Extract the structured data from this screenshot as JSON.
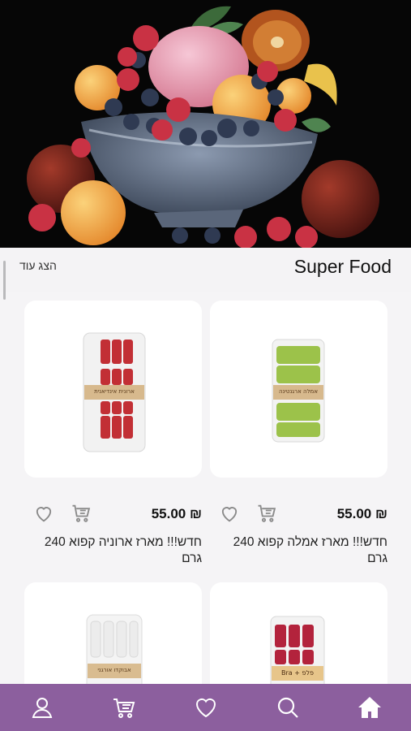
{
  "section": {
    "title": "Super Food",
    "show_more": "הצג עוד"
  },
  "products": [
    {
      "name": "חדש!!! מארז אמלה קפוא 240 גרם",
      "price": "₪ 55.00",
      "package_label": "אמלה ארגנטינה",
      "fill_color": "#9cc24a"
    },
    {
      "name": "חדש!!! מארז ארוניה קפוא 240 גרם",
      "price": "₪ 55.00",
      "package_label": "ארונית אינדיאנית",
      "fill_color": "#c22f35"
    },
    {
      "name": "",
      "price": "",
      "package_label": "Bra + פלפ",
      "fill_color": "#b3233c"
    },
    {
      "name": "",
      "price": "",
      "package_label": "אבוקדו אורגני",
      "fill_color": "#f2f2f2"
    }
  ],
  "tabbar": {
    "items": [
      "home-icon",
      "search-icon",
      "heart-icon",
      "cart-icon",
      "user-icon"
    ],
    "color": "#8c5f9e"
  }
}
